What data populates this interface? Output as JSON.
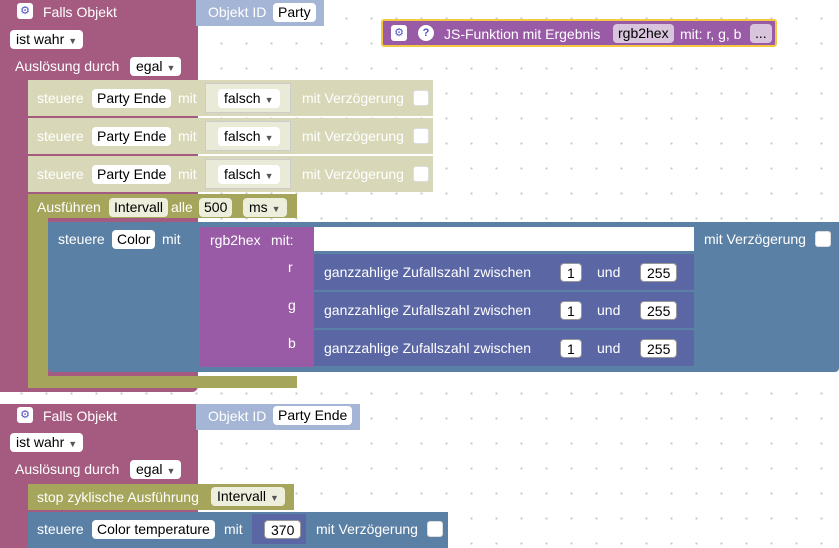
{
  "block1": {
    "header": "Falls Objekt",
    "objekt_id_label": "Objekt ID",
    "objekt_id_value": "Party",
    "condition": "ist wahr",
    "trigger_label": "Auslösung durch",
    "trigger_value": "egal"
  },
  "disabled_rows": [
    {
      "steuere": "steuere",
      "target": "Party Ende",
      "mit": "mit",
      "value": "falsch",
      "delay": "mit Verzögerung"
    },
    {
      "steuere": "steuere",
      "target": "Party Ende",
      "mit": "mit",
      "value": "falsch",
      "delay": "mit Verzögerung"
    },
    {
      "steuere": "steuere",
      "target": "Party Ende",
      "mit": "mit",
      "value": "falsch",
      "delay": "mit Verzögerung"
    }
  ],
  "interval": {
    "label": "Ausführen",
    "name": "Intervall",
    "alle": "alle",
    "value": "500",
    "unit": "ms"
  },
  "color_block": {
    "steuere": "steuere",
    "target": "Color",
    "mit": "mit",
    "delay": "mit Verzögerung",
    "func": "rgb2hex",
    "func_mit": "mit:",
    "params": [
      {
        "name": "r",
        "text": "ganzzahlige Zufallszahl zwischen",
        "from": "1",
        "und": "und",
        "to": "255"
      },
      {
        "name": "g",
        "text": "ganzzahlige Zufallszahl zwischen",
        "from": "1",
        "und": "und",
        "to": "255"
      },
      {
        "name": "b",
        "text": "ganzzahlige Zufallszahl zwischen",
        "from": "1",
        "und": "und",
        "to": "255"
      }
    ]
  },
  "js_func": {
    "label": "JS-Funktion mit Ergebnis",
    "name": "rgb2hex",
    "params": "mit: r, g, b",
    "more": "..."
  },
  "block2": {
    "header": "Falls Objekt",
    "objekt_id_label": "Objekt ID",
    "objekt_id_value": "Party Ende",
    "condition": "ist wahr",
    "trigger_label": "Auslösung durch",
    "trigger_value": "egal"
  },
  "stop_block": {
    "label": "stop zyklische Ausführung",
    "value": "Intervall"
  },
  "temp_block": {
    "steuere": "steuere",
    "target": "Color temperature",
    "mit": "mit",
    "value": "370",
    "delay": "mit Verzögerung"
  },
  "colors": {
    "event": "#a55b80",
    "objid": "#a5b5d5",
    "disabled": "#d8d8b8",
    "timer": "#a5a55b",
    "action": "#5b80a5",
    "func": "#995ba5",
    "math": "#5b67a5",
    "highlight": "#f5c842"
  }
}
